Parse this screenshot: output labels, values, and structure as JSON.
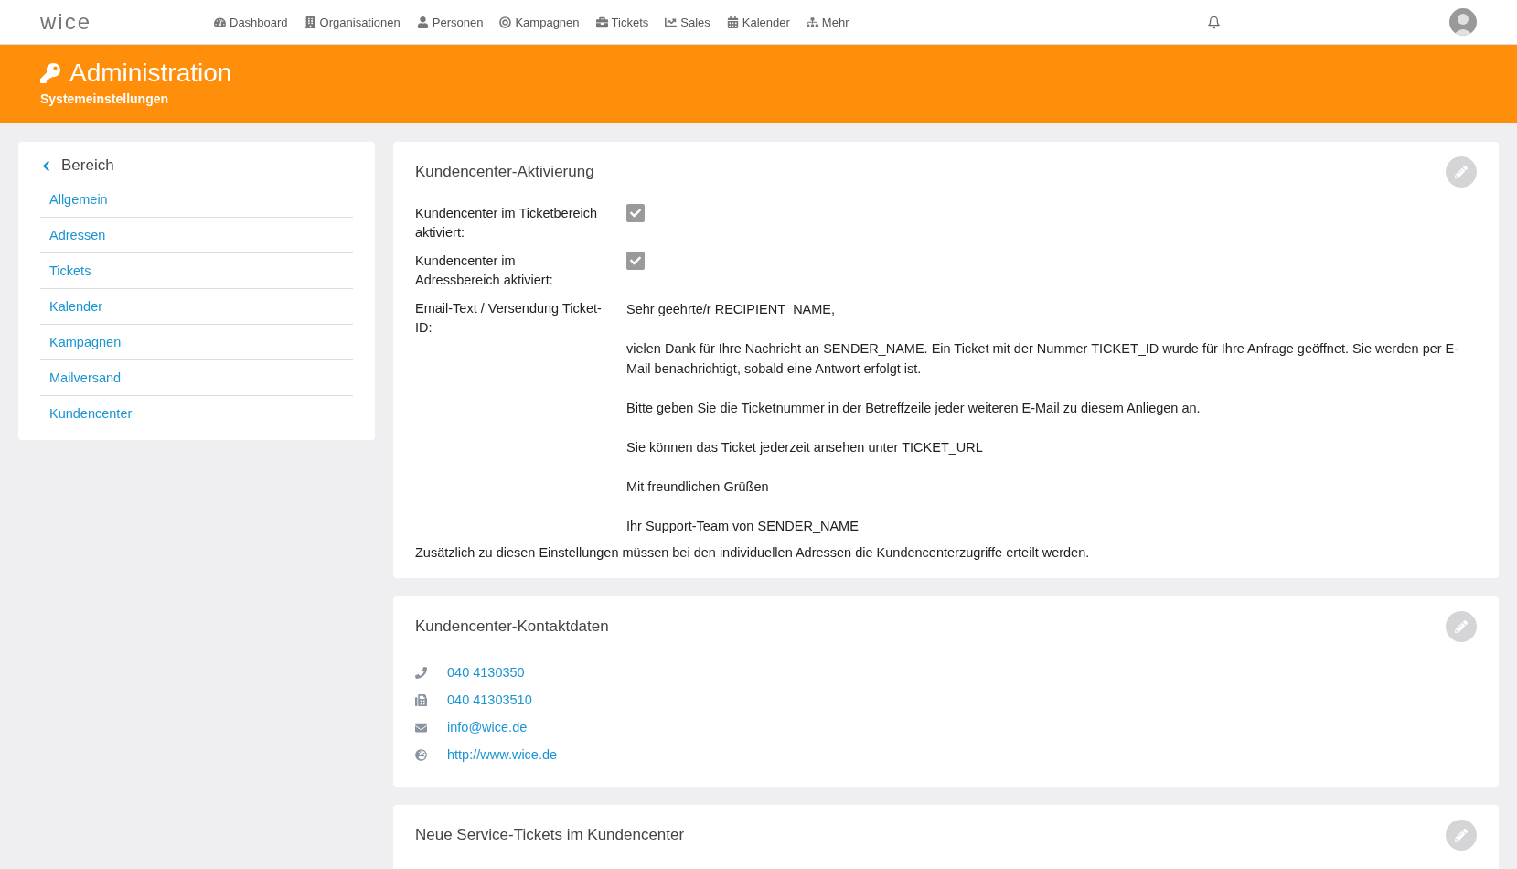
{
  "topbar": {
    "logo": "wice",
    "nav": [
      {
        "label": "Dashboard",
        "kind": "dashboard"
      },
      {
        "label": "Organisationen",
        "kind": "building"
      },
      {
        "label": "Personen",
        "kind": "person"
      },
      {
        "label": "Kampagnen",
        "kind": "target"
      },
      {
        "label": "Tickets",
        "kind": "briefcase"
      },
      {
        "label": "Sales",
        "kind": "chart"
      },
      {
        "label": "Kalender",
        "kind": "calendar"
      },
      {
        "label": "Mehr",
        "kind": "sitemap"
      }
    ]
  },
  "header": {
    "title": "Administration",
    "subtitle": "Systemeinstellungen"
  },
  "sidebar": {
    "title": "Bereich",
    "items": [
      {
        "label": "Allgemein"
      },
      {
        "label": "Adressen"
      },
      {
        "label": "Tickets"
      },
      {
        "label": "Kalender"
      },
      {
        "label": "Kampagnen"
      },
      {
        "label": "Mailversand"
      },
      {
        "label": "Kundencenter"
      }
    ]
  },
  "activation": {
    "title": "Kundencenter-Aktivierung",
    "fields": [
      {
        "label": "Kundencenter im Ticketbereich aktiviert:",
        "checked": true
      },
      {
        "label": "Kundencenter im Adressbereich aktiviert:",
        "checked": true
      }
    ],
    "email_label": "Email-Text / Versendung Ticket-ID:",
    "email_text": [
      "Sehr geehrte/r RECIPIENT_NAME,",
      "vielen Dank für Ihre Nachricht an SENDER_NAME. Ein Ticket mit der Nummer TICKET_ID wurde für Ihre Anfrage geöffnet. Sie werden per E-Mail benachrichtigt, sobald eine Antwort erfolgt ist.",
      "Bitte geben Sie die Ticketnummer in der Betreffzeile jeder weiteren E-Mail zu diesem Anliegen an.",
      "Sie können das Ticket jederzeit ansehen unter TICKET_URL",
      "Mit freundlichen Grüßen",
      "Ihr Support-Team von SENDER_NAME"
    ],
    "note": "Zusätzlich zu diesen Einstellungen müssen bei den individuellen Adressen die Kundencenterzugriffe erteilt werden."
  },
  "contact": {
    "title": "Kundencenter-Kontaktdaten",
    "items": [
      {
        "kind": "phone",
        "value": "040 4130350"
      },
      {
        "kind": "fax",
        "value": "040 41303510"
      },
      {
        "kind": "email",
        "value": "info@wice.de"
      },
      {
        "kind": "web",
        "value": "http://www.wice.de"
      }
    ]
  },
  "tickets": {
    "title": "Neue Service-Tickets im Kundencenter"
  }
}
